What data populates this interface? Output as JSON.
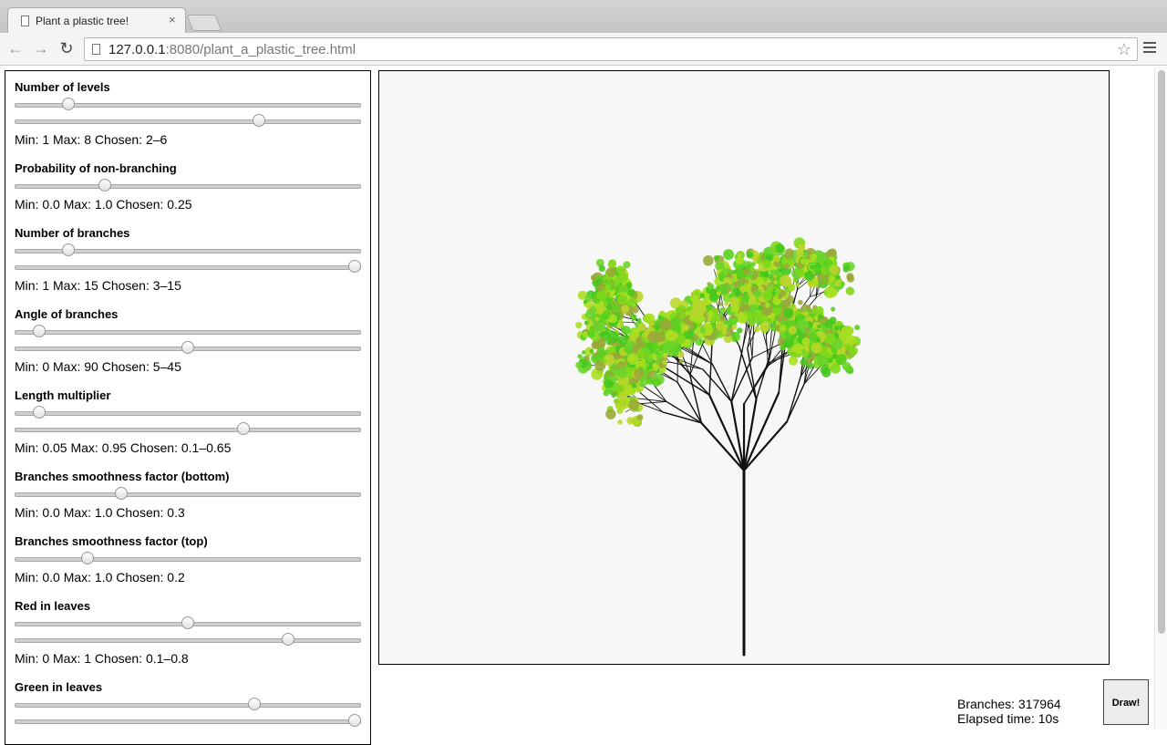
{
  "browser": {
    "tab_title": "Plant a plastic tree!",
    "tab_close": "×",
    "url_host": "127.0.0.1",
    "url_rest": ":8080/plant_a_plastic_tree.html",
    "back": "←",
    "forward": "→",
    "reload": "↻",
    "star": "☆"
  },
  "controls": [
    {
      "label": "Number of levels",
      "info": "Min: 1 Max: 8 Chosen: 2–6",
      "min": 1,
      "max": 8,
      "values": [
        2,
        6
      ]
    },
    {
      "label": "Probability of non-branching",
      "info": "Min: 0.0 Max: 1.0 Chosen: 0.25",
      "min": 0.0,
      "max": 1.0,
      "values": [
        0.25
      ]
    },
    {
      "label": "Number of branches",
      "info": "Min: 1 Max: 15 Chosen: 3–15",
      "min": 1,
      "max": 15,
      "values": [
        3,
        15
      ]
    },
    {
      "label": "Angle of branches",
      "info": "Min: 0 Max: 90 Chosen: 5–45",
      "min": 0,
      "max": 90,
      "values": [
        5,
        45
      ]
    },
    {
      "label": "Length multiplier",
      "info": "Min: 0.05 Max: 0.95 Chosen: 0.1–0.65",
      "min": 0.05,
      "max": 0.95,
      "values": [
        0.1,
        0.65
      ]
    },
    {
      "label": "Branches smoothness factor (bottom)",
      "info": "Min: 0.0 Max: 1.0 Chosen: 0.3",
      "min": 0.0,
      "max": 1.0,
      "values": [
        0.3
      ]
    },
    {
      "label": "Branches smoothness factor (top)",
      "info": "Min: 0.0 Max: 1.0 Chosen: 0.2",
      "min": 0.0,
      "max": 1.0,
      "values": [
        0.2
      ]
    },
    {
      "label": "Red in leaves",
      "info": "Min: 0 Max: 1 Chosen: 0.1–0.8",
      "min": 0,
      "max": 1,
      "values": [
        0.5,
        0.8
      ]
    },
    {
      "label": "Green in leaves",
      "info": "",
      "min": 0,
      "max": 1,
      "values": [
        0.7,
        1.0
      ]
    }
  ],
  "stats": {
    "branches": "Branches: 317964",
    "elapsed": "Elapsed time: 10s"
  },
  "draw_button": "Draw!",
  "colors": {
    "canvas_bg": "#f7f7f7",
    "branch": "#111111",
    "leaf_green": "#5ad21e",
    "leaf_yellow": "#a8e01e",
    "leaf_olive": "#9aa83a"
  }
}
